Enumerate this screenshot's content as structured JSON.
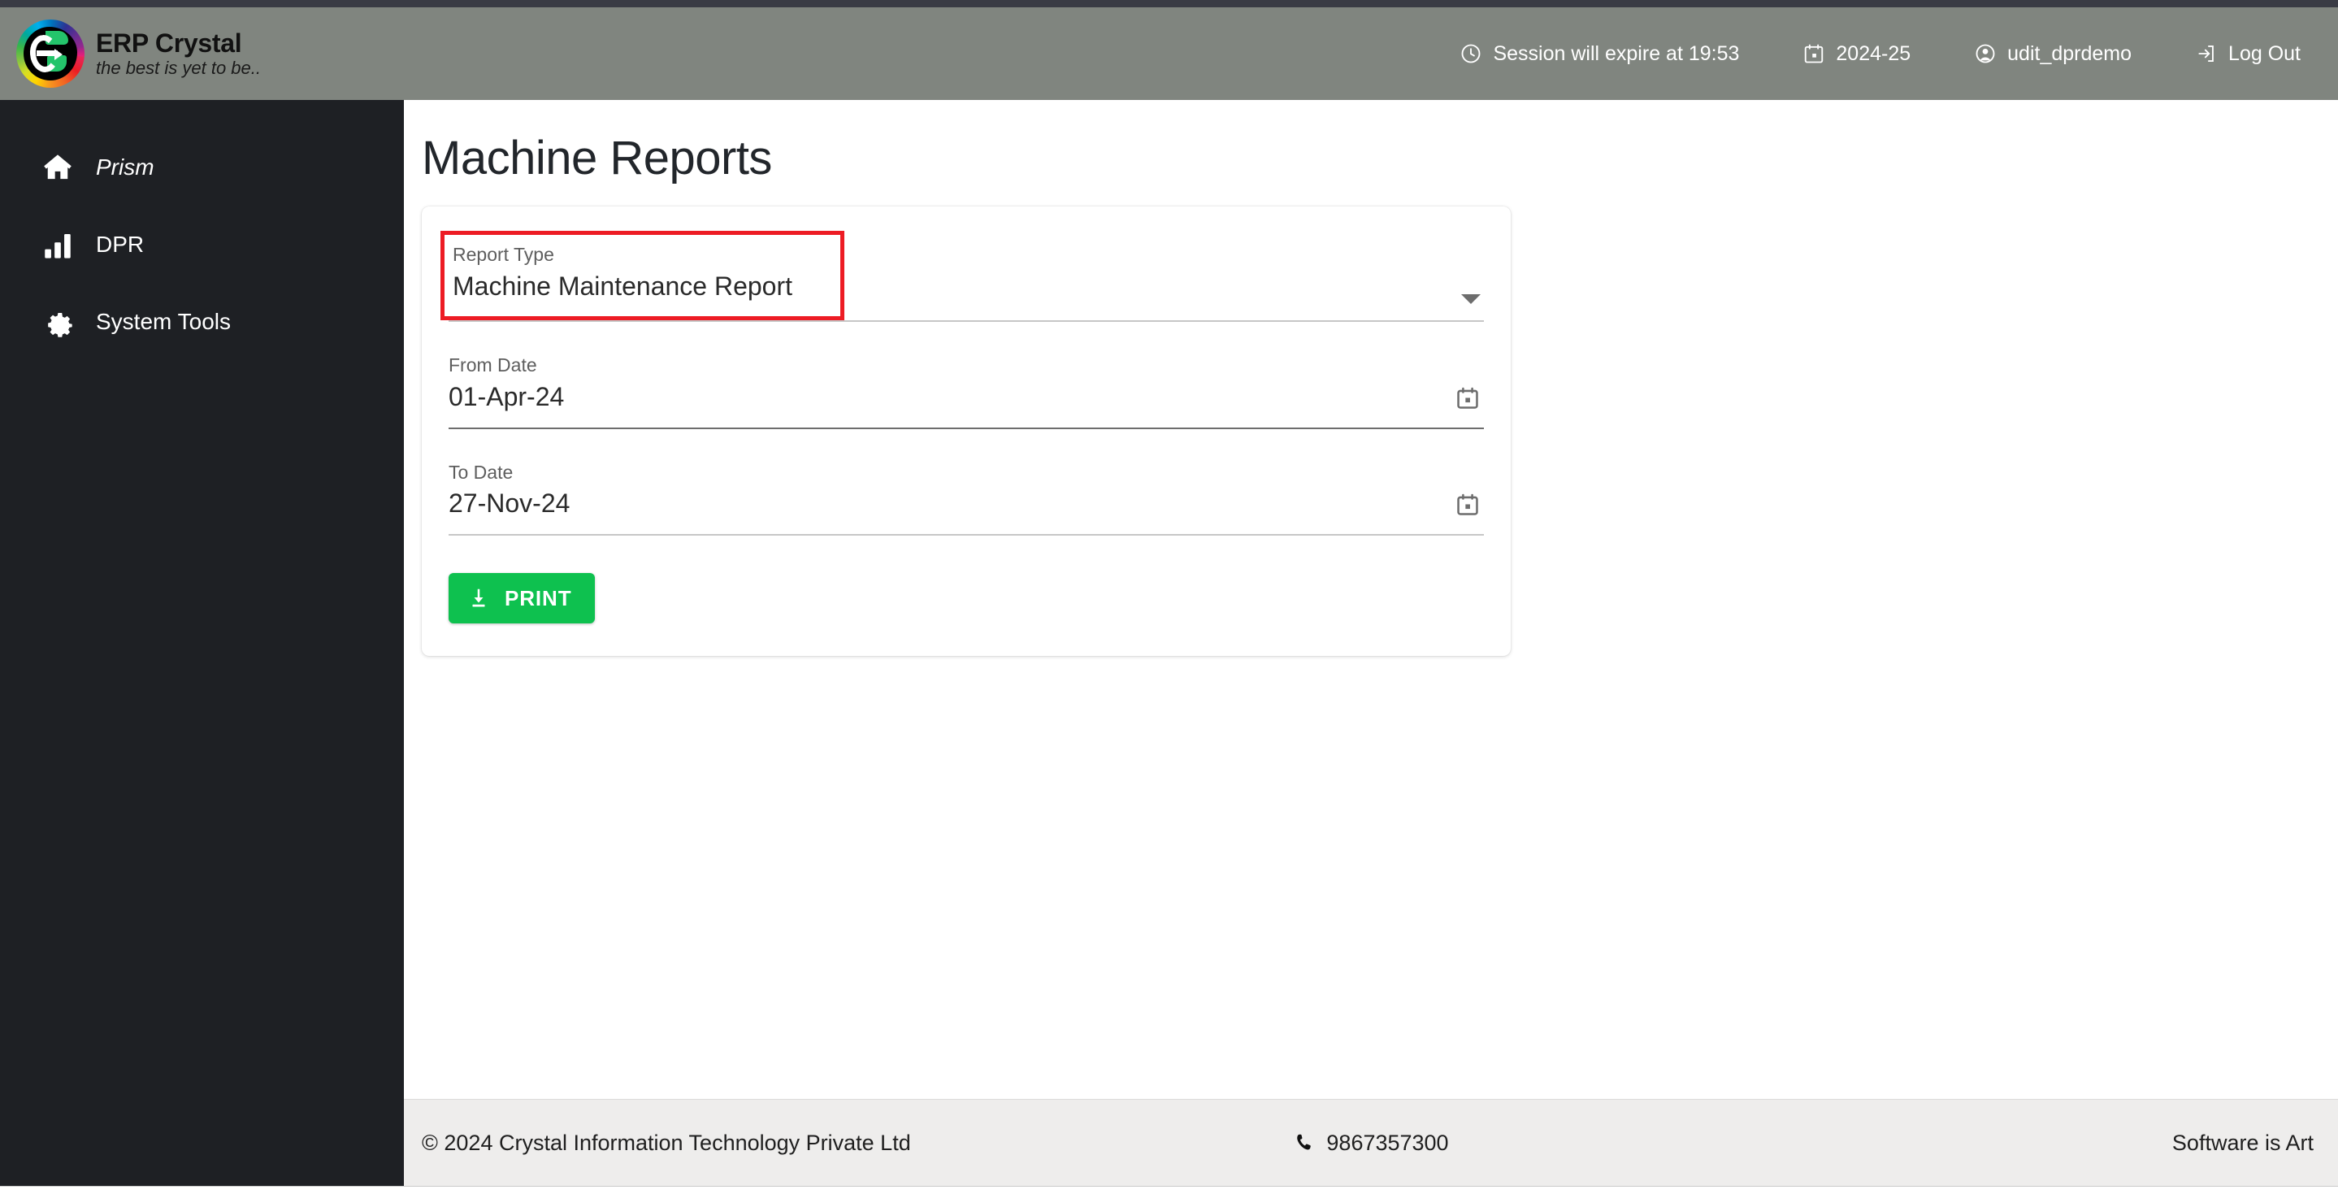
{
  "header": {
    "brand_title": "ERP Crystal",
    "brand_tagline": "the best is yet to be..",
    "logo_icon": "erp-crystal-logo",
    "session": {
      "icon": "clock-icon",
      "label": "Session will expire at 19:53"
    },
    "fiscal_year": {
      "icon": "calendar-icon",
      "label": "2024-25"
    },
    "user": {
      "icon": "user-circle-icon",
      "label": "udit_dprdemo"
    },
    "logout": {
      "icon": "logout-icon",
      "label": "Log Out"
    }
  },
  "sidebar": {
    "items": [
      {
        "icon": "home-icon",
        "label": "Prism",
        "italic": true
      },
      {
        "icon": "bar-chart-icon",
        "label": "DPR",
        "italic": false
      },
      {
        "icon": "gear-icon",
        "label": "System Tools",
        "italic": false
      }
    ]
  },
  "main": {
    "page_title": "Machine Reports",
    "form": {
      "report_type": {
        "label": "Report Type",
        "value": "Machine Maintenance Report",
        "adornment_icon": "chevron-down-icon",
        "highlighted": true
      },
      "from_date": {
        "label": "From Date",
        "value": "01-Apr-24",
        "adornment_icon": "calendar-icon"
      },
      "to_date": {
        "label": "To Date",
        "value": "27-Nov-24",
        "adornment_icon": "calendar-icon"
      },
      "print_button": {
        "icon": "download-icon",
        "label": "PRINT"
      }
    }
  },
  "footer": {
    "copyright": "© 2024 Crystal Information Technology Private Ltd",
    "phone": {
      "icon": "phone-icon",
      "label": "9867357300"
    },
    "tagline": "Software is Art"
  },
  "colors": {
    "header_bg": "#80857f",
    "sidebar_bg": "#1e2024",
    "accent_green": "#0ec14f",
    "highlight_red": "#ed1c24",
    "footer_bg": "#eeedec"
  }
}
